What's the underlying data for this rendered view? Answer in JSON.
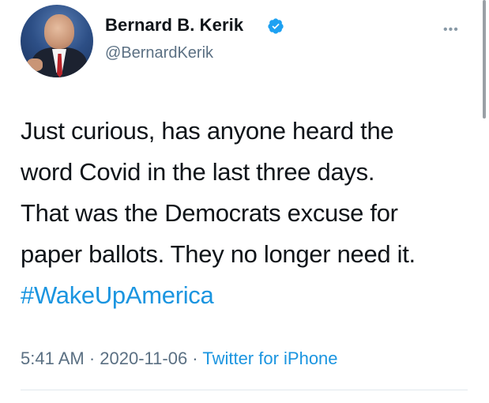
{
  "user": {
    "display_name": "Bernard B. Kerik",
    "handle": "@BernardKerik",
    "verified": true
  },
  "tweet": {
    "lines": [
      "Just curious, has anyone heard the",
      "word Covid in the last three days.",
      "That was the Democrats excuse for",
      "paper ballots. They no longer need it."
    ],
    "hashtag": "#WakeUpAmerica"
  },
  "meta": {
    "time": "5:41 AM",
    "separator1": " · ",
    "date": "2020-11-06",
    "separator2": " · ",
    "source": "Twitter for iPhone"
  },
  "icons": {
    "verified": "verified-badge-icon",
    "more": "more-options-icon"
  },
  "colors": {
    "link": "#1b95e0",
    "secondary_text": "#5b7083",
    "verified_badge": "#1da1f2"
  }
}
